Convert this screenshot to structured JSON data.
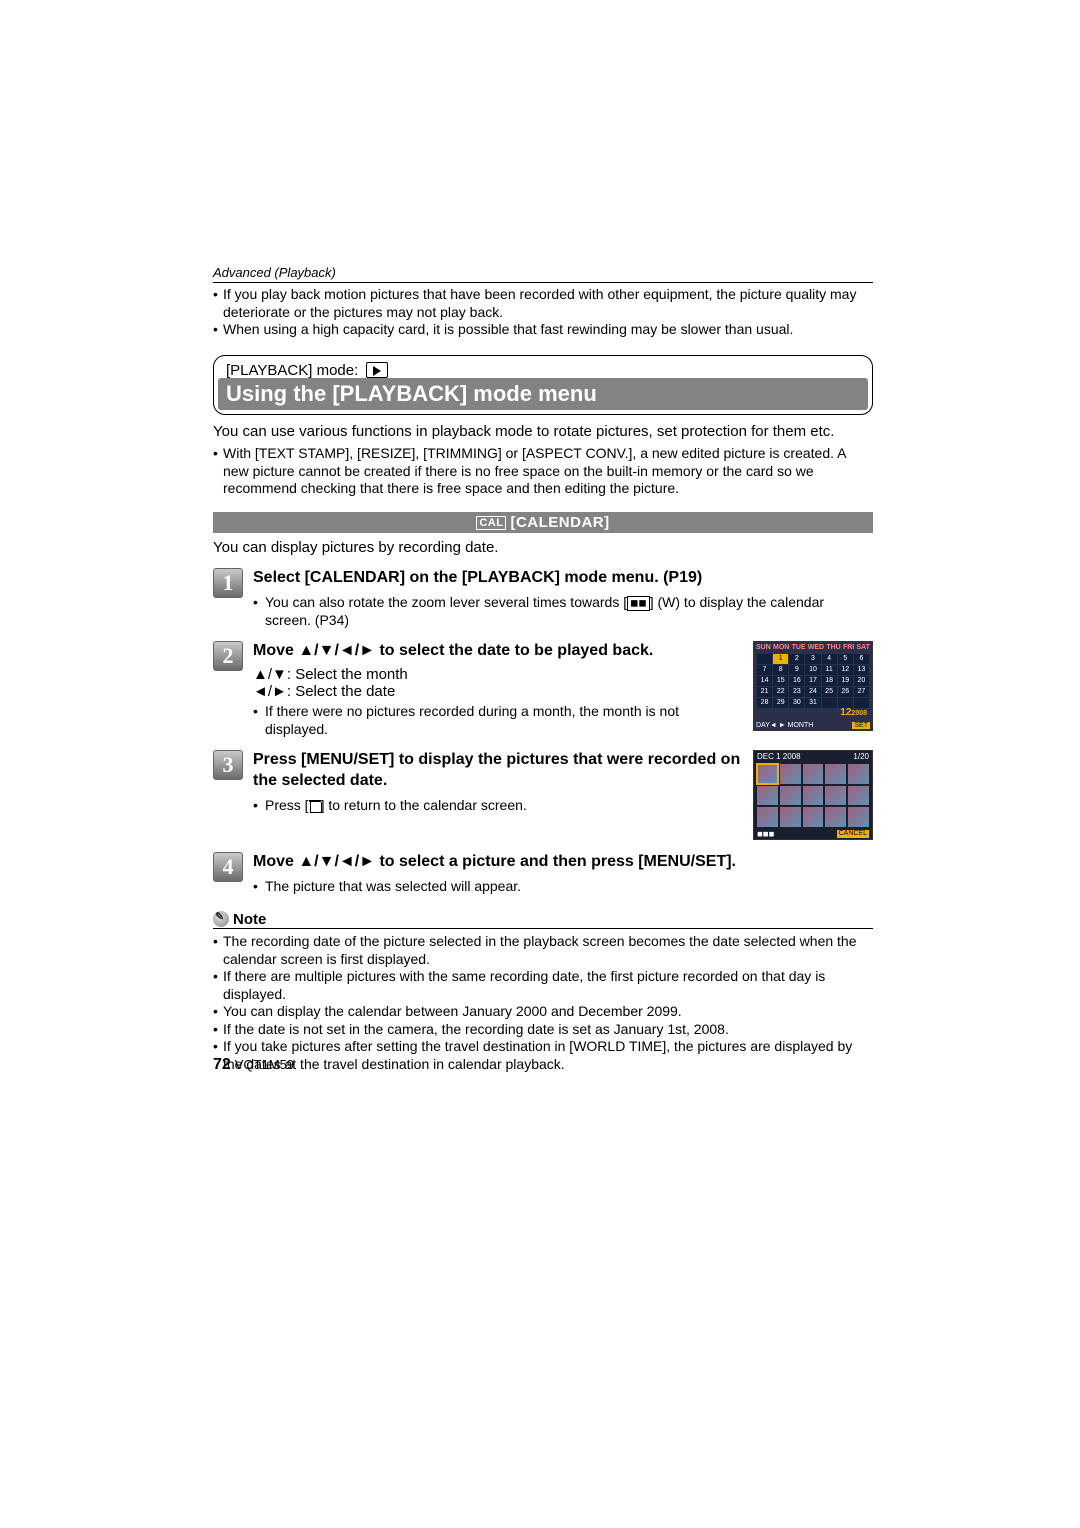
{
  "header": {
    "section": "Advanced (Playback)"
  },
  "top_bullets": [
    "If you play back motion pictures that have been recorded with other equipment, the picture quality may deteriorate or the pictures may not play back.",
    "When using a high capacity card, it is possible that fast rewinding may be slower than usual."
  ],
  "mode_label": "[PLAYBACK] mode:",
  "title": "Using the [PLAYBACK] mode menu",
  "intro": "You can use various functions in playback mode to rotate pictures, set protection for them etc.",
  "intro_bullets": [
    "With [TEXT STAMP], [RESIZE], [TRIMMING] or [ASPECT CONV.], a new edited picture is created. A new picture cannot be created if there is no free space on the built-in memory or the card so we recommend checking that there is free space and then editing the picture."
  ],
  "feature": {
    "icon": "CAL",
    "name": "[CALENDAR]"
  },
  "feature_desc": "You can display pictures by recording date.",
  "steps": [
    {
      "num": "1",
      "title": "Select [CALENDAR] on the [PLAYBACK] mode menu. (P19)",
      "detail_prefix": "You can also rotate the zoom lever several times towards [",
      "detail_suffix": "] (W) to display the calendar screen. (P34)"
    },
    {
      "num": "2",
      "title_prefix": "Move ",
      "title_arrows": "▲/▼/◄/►",
      "title_suffix": " to select the date to be played back.",
      "line1_arrows": "▲/▼",
      "line1_text": ":  Select the month",
      "line2_arrows": "◄/►",
      "line2_text": ":  Select the date",
      "bullet": "If there were no pictures recorded during a month, the month is not displayed."
    },
    {
      "num": "3",
      "title": "Press [MENU/SET] to display the pictures that were recorded on the selected date.",
      "detail_prefix": "Press [",
      "detail_suffix": "] to return to the calendar screen."
    },
    {
      "num": "4",
      "title_prefix": "Move ",
      "title_arrows": "▲/▼/◄/►",
      "title_suffix": " to select a picture and then press [MENU/SET].",
      "bullet": "The picture that was selected will appear."
    }
  ],
  "note_label": "Note",
  "notes": [
    "The recording date of the picture selected in the playback screen becomes the date selected when the calendar screen is first displayed.",
    "If there are multiple pictures with the same recording date, the first picture recorded on that day is displayed.",
    "You can display the calendar between January 2000 and December 2099.",
    "If the date is not set in the camera, the recording date is set as January 1st, 2008.",
    "If you take pictures after setting the travel destination in [WORLD TIME], the pictures are displayed by the dates at the travel destination in calendar playback."
  ],
  "cal_screen": {
    "days": [
      "SUN",
      "MON",
      "TUE",
      "WED",
      "THU",
      "FRI",
      "SAT"
    ],
    "month": "12",
    "year": "2008",
    "footer_left": "DAY◄ ►  MONTH",
    "footer_right": "SET"
  },
  "thumb_screen": {
    "date": "DEC  1 2008",
    "count": "1/20",
    "cancel": "CANCEL"
  },
  "footer": {
    "page": "72",
    "code": "VQT1M59"
  }
}
